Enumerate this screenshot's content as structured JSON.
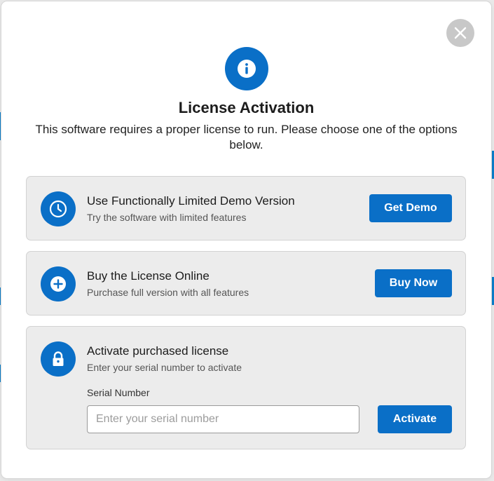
{
  "dialog": {
    "title": "License Activation",
    "subtitle": "This software requires a proper license to run. Please choose one of the options below."
  },
  "close": {
    "icon": "close-icon"
  },
  "header_icon": "info-icon",
  "options": {
    "demo": {
      "icon": "clock-icon",
      "title": "Use Functionally Limited Demo Version",
      "description": "Try the software with limited features",
      "button_label": "Get Demo"
    },
    "buy": {
      "icon": "plus-circle-icon",
      "title": "Buy the License Online",
      "description": "Purchase full version with all features",
      "button_label": "Buy Now"
    },
    "activate": {
      "icon": "lock-icon",
      "title": "Activate purchased license",
      "description": "Enter your serial number to activate",
      "field_label": "Serial Number",
      "field_placeholder": "Enter your serial number",
      "field_value": "",
      "button_label": "Activate"
    }
  },
  "colors": {
    "accent": "#0a6fc7",
    "card_background": "#ececec",
    "close_background": "#c8c8c8"
  }
}
